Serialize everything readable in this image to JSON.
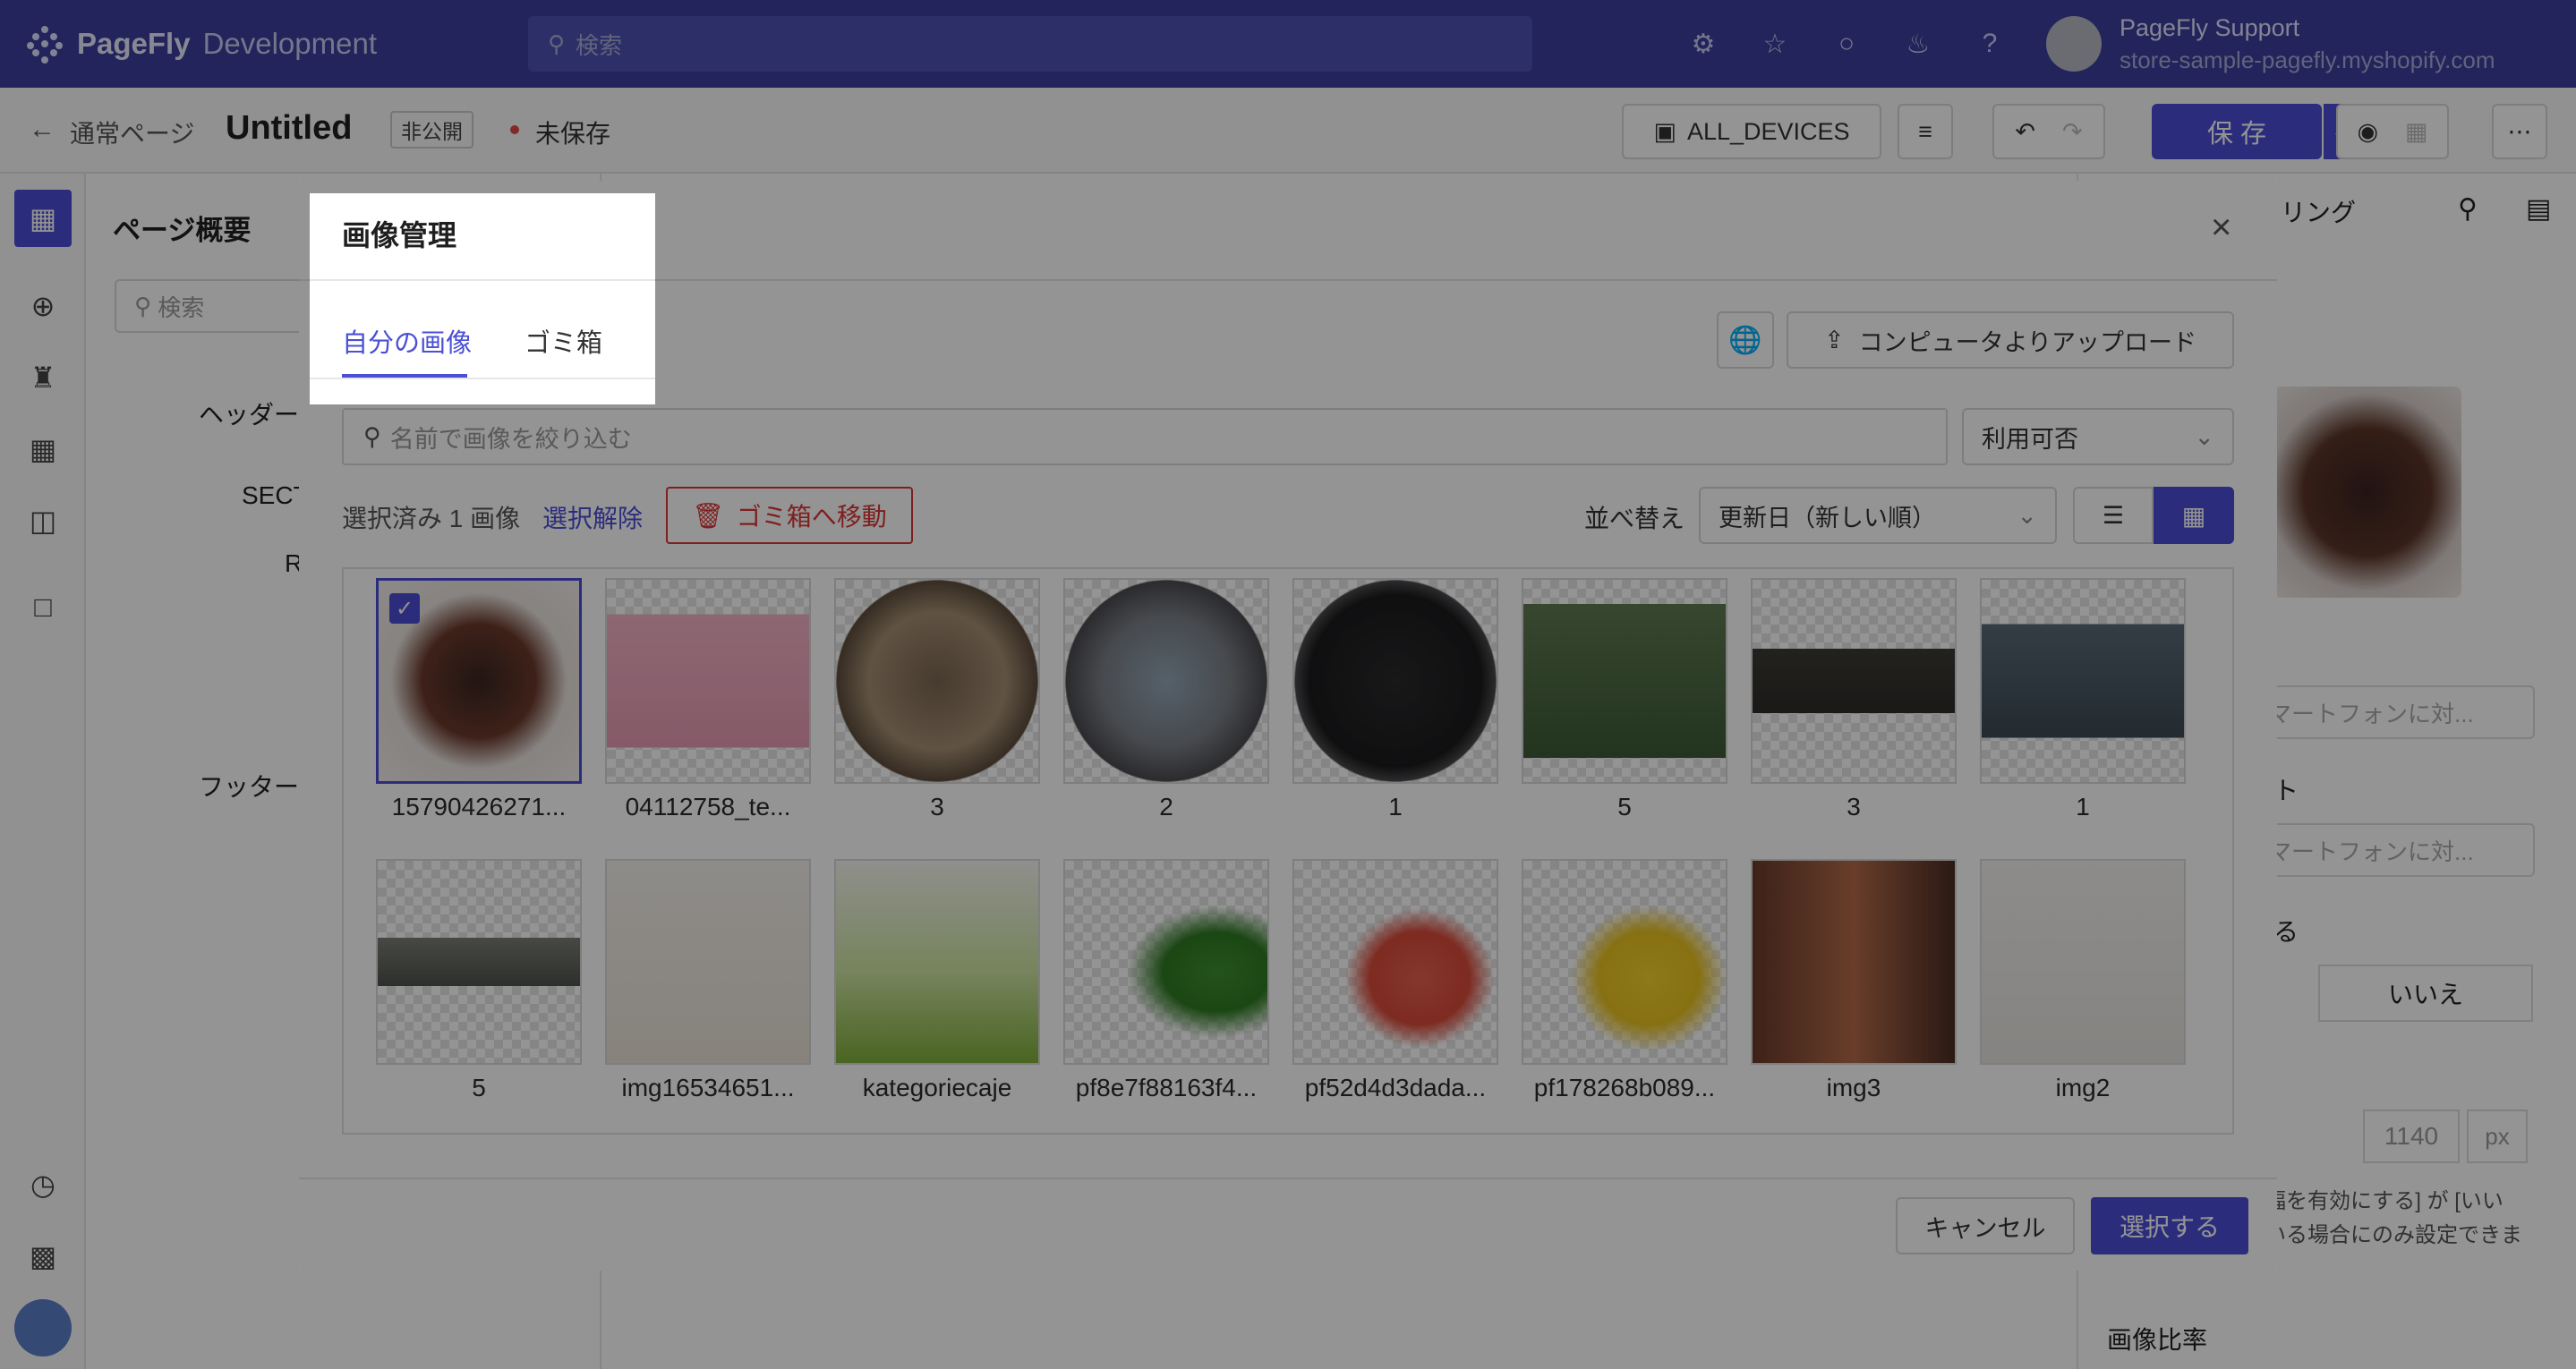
{
  "topbar": {
    "brand": "PageFly",
    "brand_suffix": "Development",
    "search_placeholder": "検索",
    "user_name": "PageFly Support",
    "user_store": "store-sample-pagefly.myshopify.com",
    "icons": [
      "settings-icon",
      "star-icon",
      "chat-icon",
      "bell-icon",
      "help-icon"
    ]
  },
  "subbar": {
    "back_label": "通常ページ",
    "page_title": "Untitled",
    "visibility_badge": "非公開",
    "status_text": "未保存",
    "device_label": "ALL_DEVICES",
    "save_label": "保 存"
  },
  "left_panel": {
    "title": "ページ概要",
    "search_placeholder": "検索",
    "items": [
      "ヘッダー",
      "SECT",
      "R",
      "フッター"
    ]
  },
  "right_panel": {
    "tab_partial": "イリング",
    "placeholder_1": "マートフォンに対...",
    "label_partial_1": "ト",
    "placeholder_2": "マートフォンに対...",
    "label_partial_2": "る",
    "no_button": "いいえ",
    "width_value": "1140",
    "width_unit": "px",
    "note_line_1": "幅を有効にする] が [いい",
    "note_line_2": "いる場合にのみ設定できま",
    "aspect_label": "画像比率"
  },
  "modal": {
    "title": "画像管理",
    "tabs": [
      "自分の画像",
      "ゴミ箱"
    ],
    "upload_button": "コンピュータよりアップロード",
    "filter_placeholder": "名前で画像を絞り込む",
    "availability_select": "利用可否",
    "selected_text": "選択済み 1 画像",
    "deselect_link": "選択解除",
    "trash_button": "ゴミ箱へ移動",
    "sort_label": "並べ替え",
    "sort_select": "更新日（新しい順）",
    "cancel_button": "キャンセル",
    "select_button": "選択する",
    "images": [
      {
        "caption": "15790426271...",
        "selected": true
      },
      {
        "caption": "04112758_te..."
      },
      {
        "caption": "3"
      },
      {
        "caption": "2"
      },
      {
        "caption": "1"
      },
      {
        "caption": "5"
      },
      {
        "caption": "3"
      },
      {
        "caption": "1"
      },
      {
        "caption": "5"
      },
      {
        "caption": "img16534651..."
      },
      {
        "caption": "kategoriecaje"
      },
      {
        "caption": "pf8e7f88163f4..."
      },
      {
        "caption": "pf52d4d3dada..."
      },
      {
        "caption": "pf178268b089..."
      },
      {
        "caption": "img3"
      },
      {
        "caption": "img2"
      }
    ]
  },
  "colors": {
    "accent": "#4a4fd6",
    "topbar": "#3b3f9e",
    "danger": "#d93636"
  }
}
